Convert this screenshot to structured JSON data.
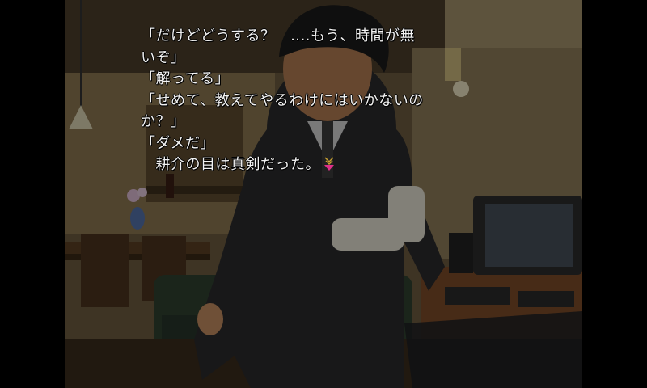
{
  "dialogue": {
    "lines": [
      "「だけどどうする？　‥‥もう、時間が無",
      "いぞ」",
      "「解ってる」",
      "「せめて、教えてやるわけにはいかないの",
      "か？」",
      "「ダメだ」",
      "　耕介の目は真剣だった。"
    ]
  },
  "ui": {
    "wait_icon": "page-wait-icon",
    "wait_icon_color": "#e0308a"
  }
}
